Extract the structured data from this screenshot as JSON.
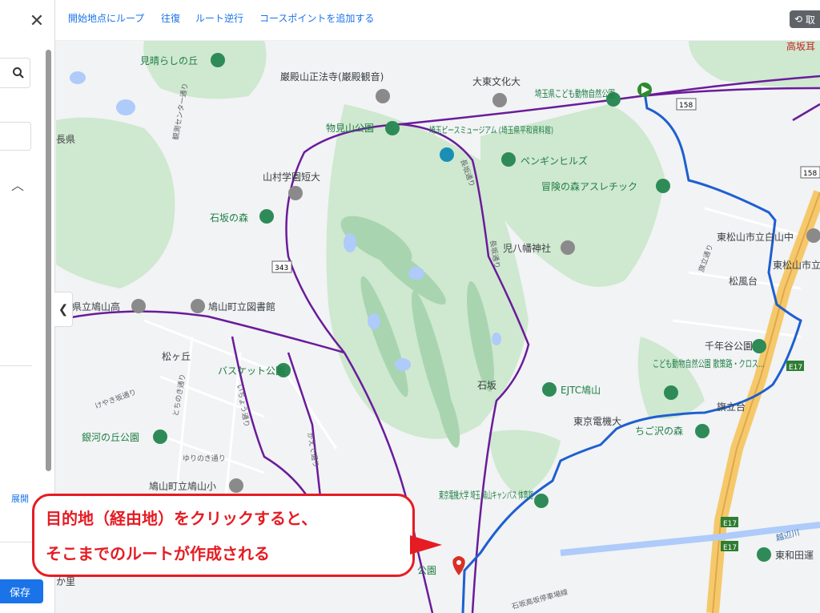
{
  "left_panel": {
    "partial_label": "長県",
    "expand_label": "展開",
    "save_label": "保存",
    "partial_bottom_text": "か里"
  },
  "toolbar": {
    "loop_label": "開始地点にループ",
    "roundtrip_label": "往復",
    "reverse_label": "ルート逆行",
    "add_point_label": "コースポイントを追加する",
    "undo_label": "取"
  },
  "map": {
    "labels": {
      "miharashi": "見晴らしの丘",
      "ganden": "巌殿山正法寺(巌殿観音)",
      "daito": "大東文化大",
      "saitama_zoo": "埼玉県こども動物自然公園",
      "monomiyama": "物見山公園",
      "peace_museum": "埼玉ピースミュージアム (埼玉県平和資料館)",
      "penguin": "ペンギンヒルズ",
      "adventure": "冒険の森アスレチック",
      "yamamura": "山村学園短大",
      "ishizaka_forest": "石坂の森",
      "hachiman": "児八幡神社",
      "hatoyama_hs": "県立鳩山高",
      "library": "鳩山町立図書館",
      "matsugaoka": "松ヶ丘",
      "basket": "バスケット公園",
      "ishizaka": "石坂",
      "ejtc": "EJTC鳩山",
      "tdu": "東京電機大",
      "tdu_campus": "東京電機大学 埼玉 鳩山キャンパス 体育館",
      "ginga": "銀河の丘公園",
      "hatoyama_es": "鳩山町立鳩山小",
      "kouen": "公園",
      "kodomo_park": "こども動物自然公園 散策路・クロス…",
      "chigosawa": "ちご沢の森",
      "sennen": "千年谷公園",
      "matsukazedai": "松風台",
      "higashimatsuyama_jhs": "東松山市立白山中",
      "higashimatsuyama2": "東松山市立",
      "takasaka": "高坂耳",
      "higashiwada": "東和田運",
      "hatatsudai": "旗立台",
      "road_158": "158",
      "road_343": "343",
      "road_e17a": "E17",
      "road_e17b": "E17",
      "road_e17c": "E17",
      "ekoshi": "越辺川",
      "street1": "観測センター通り",
      "street2": "長坂通り",
      "street3": "長坂通り",
      "street4": "けやき坂通り",
      "street5": "とちのき通り",
      "street6": "いちょう通り",
      "street7": "ゆりのき通り",
      "street8": "かえで通り",
      "street9": "石坂高坂停車場線",
      "street10": "旗立通り"
    }
  },
  "callout": {
    "line1": "目的地（経由地）をクリックすると、",
    "line2": "そこまでのルートが作成される"
  },
  "colors": {
    "route_blue": "#1e5fd0",
    "road_purple": "#6a1b9a",
    "callout_red": "#e51c23",
    "map_green": "#c8e6c9",
    "link_blue": "#1a73e8"
  }
}
